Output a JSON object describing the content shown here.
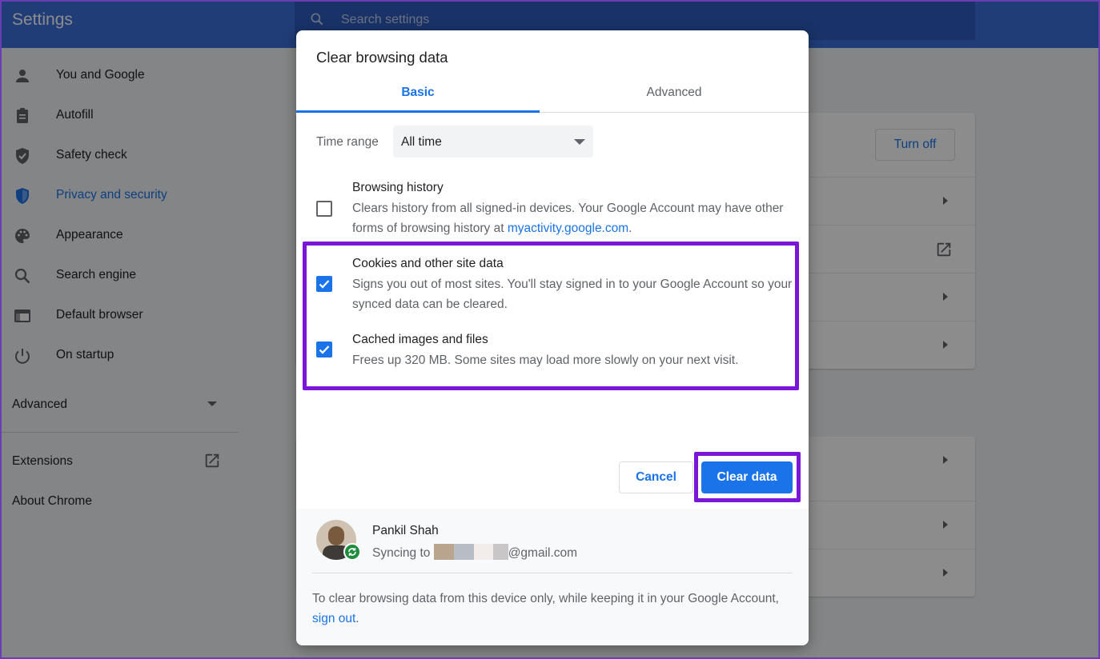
{
  "settings": {
    "title": "Settings",
    "search_placeholder": "Search settings",
    "nav": [
      {
        "label": "You and Google",
        "icon": "person-icon"
      },
      {
        "label": "Autofill",
        "icon": "clipboard-icon"
      },
      {
        "label": "Safety check",
        "icon": "shield-check-icon"
      },
      {
        "label": "Privacy and security",
        "icon": "shield-icon",
        "active": true
      },
      {
        "label": "Appearance",
        "icon": "palette-icon"
      },
      {
        "label": "Search engine",
        "icon": "search-icon"
      },
      {
        "label": "Default browser",
        "icon": "browser-icon"
      },
      {
        "label": "On startup",
        "icon": "power-icon"
      }
    ],
    "advanced_label": "Advanced",
    "extensions_label": "Extensions",
    "about_label": "About Chrome",
    "turn_off_label": "Turn off"
  },
  "dialog": {
    "title": "Clear browsing data",
    "tabs": [
      {
        "label": "Basic",
        "active": true
      },
      {
        "label": "Advanced",
        "active": false
      }
    ],
    "time_range": {
      "label": "Time range",
      "value": "All time"
    },
    "options": [
      {
        "title": "Browsing history",
        "desc_before": "Clears history from all signed-in devices. Your Google Account may have other forms of browsing history at ",
        "link": "myactivity.google.com",
        "desc_after": ".",
        "checked": false
      },
      {
        "title": "Cookies and other site data",
        "desc": "Signs you out of most sites. You'll stay signed in to your Google Account so your synced data can be cleared.",
        "checked": true
      },
      {
        "title": "Cached images and files",
        "desc": "Frees up 320 MB. Some sites may load more slowly on your next visit.",
        "checked": true
      }
    ],
    "cancel_label": "Cancel",
    "clear_label": "Clear data",
    "account": {
      "name": "Pankil Shah",
      "sync_prefix": "Syncing to ",
      "email_suffix": "@gmail.com"
    },
    "footer_note_before": "To clear browsing data from this device only, while keeping it in your Google Account, ",
    "footer_link": "sign out",
    "footer_note_after": "."
  },
  "colors": {
    "accent": "#1a73e8",
    "highlight": "#7a17d6",
    "topbar": "#3b6fd9"
  }
}
